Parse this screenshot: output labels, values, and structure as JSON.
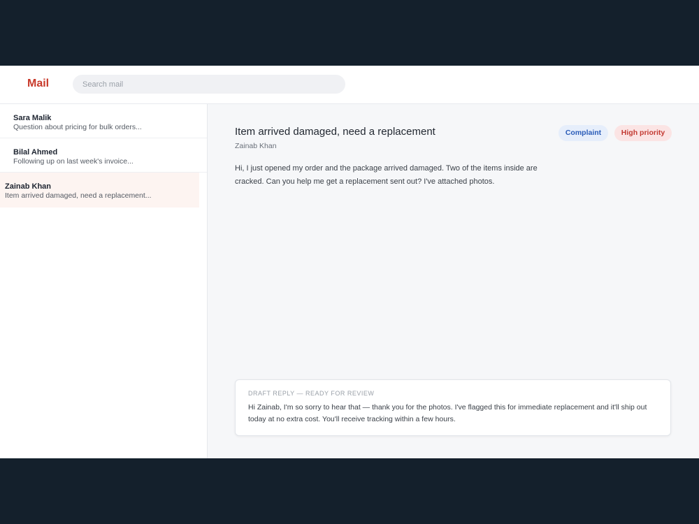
{
  "header": {
    "logo": "Mail",
    "search_placeholder": "Search mail"
  },
  "inbox": {
    "items": [
      {
        "from": "Sara Malik",
        "snippet": "Question about pricing for bulk orders..."
      },
      {
        "from": "Bilal Ahmed",
        "snippet": "Following up on last week's invoice..."
      },
      {
        "from": "Zainab Khan",
        "snippet": "Item arrived damaged, need a replacement..."
      }
    ],
    "selected_index": 2
  },
  "message": {
    "subject": "Item arrived damaged, need a replacement",
    "sender": "Zainab Khan",
    "tags": [
      "Complaint",
      "High priority"
    ],
    "body": "Hi, I just opened my order and the package arrived damaged. Two of the items inside are cracked. Can you help me get a replacement sent out? I've attached photos."
  },
  "draft": {
    "label": "DRAFT REPLY — READY FOR REVIEW",
    "text": "Hi Zainab, I'm so sorry to hear that — thank you for the photos. I've flagged this for immediate replacement and it'll ship out today at no extra cost. You'll receive tracking within a few hours."
  },
  "colors": {
    "brand": "#c83a2b",
    "complaint_badge": "#2a5cb8",
    "priority_badge": "#c33a32",
    "frame_background": "#14202c"
  }
}
